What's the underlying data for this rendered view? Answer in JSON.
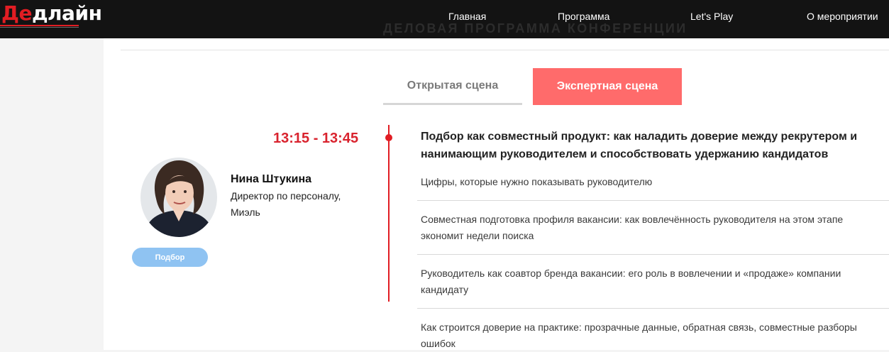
{
  "brand": {
    "logo_red": "Де",
    "logo_white": "длайн"
  },
  "nav": {
    "items": [
      "Главная",
      "Программа",
      "Let's Play",
      "О мероприятии"
    ]
  },
  "section": {
    "background_title": "ДЕЛОВАЯ ПРОГРАММА КОНФЕРЕНЦИИ"
  },
  "tabs": {
    "open": "Открытая сцена",
    "expert": "Экспертная сцена",
    "active": "expert"
  },
  "session": {
    "time": "13:15 - 13:45",
    "speaker": {
      "name": "Нина Штукина",
      "role": "Директор по персоналу, Миэль",
      "tag": "Подбор"
    },
    "title_line1": "Подбор как совместный продукт: как наладить доверие между рекрутером и",
    "title_line2": "нанимающим руководителем и способствовать удержанию кандидатов",
    "points": [
      "Цифры, которые нужно показывать руководителю",
      "Совместная подготовка профиля вакансии: как вовлечённость руководителя на этом этапе экономит недели поиска",
      "Руководитель как соавтор бренда вакансии: его роль в вовлечении и «продаже» компании кандидату",
      "Как строится доверие на практике: прозрачные данные, обратная связь, совместные разборы ошибок"
    ]
  },
  "colors": {
    "accent_red": "#e11d23",
    "tab_active": "#ff6b6b",
    "tag_blue": "#8fc3f2",
    "topbar": "#131313"
  }
}
